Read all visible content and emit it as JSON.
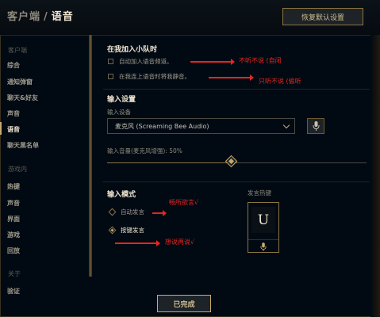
{
  "header": {
    "breadcrumb_root": "客户端",
    "breadcrumb_sep": "/",
    "breadcrumb_current": "语音",
    "reset_label": "恢复默认设置"
  },
  "sidebar": {
    "group_client": "客户端",
    "client_items": [
      "综合",
      "通知弹窗",
      "聊天&好友",
      "声音",
      "语音",
      "聊天黑名单"
    ],
    "group_ingame": "游戏内",
    "ingame_items": [
      "热键",
      "声音",
      "界面",
      "游戏",
      "回放"
    ],
    "group_about": "关于",
    "about_items": [
      "验证"
    ],
    "active_item": "语音"
  },
  "party": {
    "title": "在我加入小队时",
    "auto_join_label": "自动加入语音频道。",
    "auto_join_checked": false,
    "mute_label": "在我连上语音时将我静音。",
    "mute_checked": false
  },
  "input_settings": {
    "title": "输入设置",
    "device_label": "输入设备",
    "device_value": "麦克风 (Screaming Bee Audio)",
    "volume_label": "输入音量(麦克风增强): 50%",
    "volume_percent": 50
  },
  "input_mode": {
    "title": "输入模式",
    "options": [
      "自动发言",
      "按键发言"
    ],
    "selected": "按键发言",
    "hotkey_label": "发言热键",
    "hotkey_key": "U"
  },
  "annotations": {
    "a1": "不听不说 (自闭",
    "a2": "只听不说 (偷听",
    "a3": "畅所欲言√",
    "a4": "想说再说√"
  },
  "footer": {
    "done_label": "已完成"
  },
  "colors": {
    "gold": "#c8aa6e",
    "annotation_red": "#e8251f",
    "background": "#010a13"
  }
}
